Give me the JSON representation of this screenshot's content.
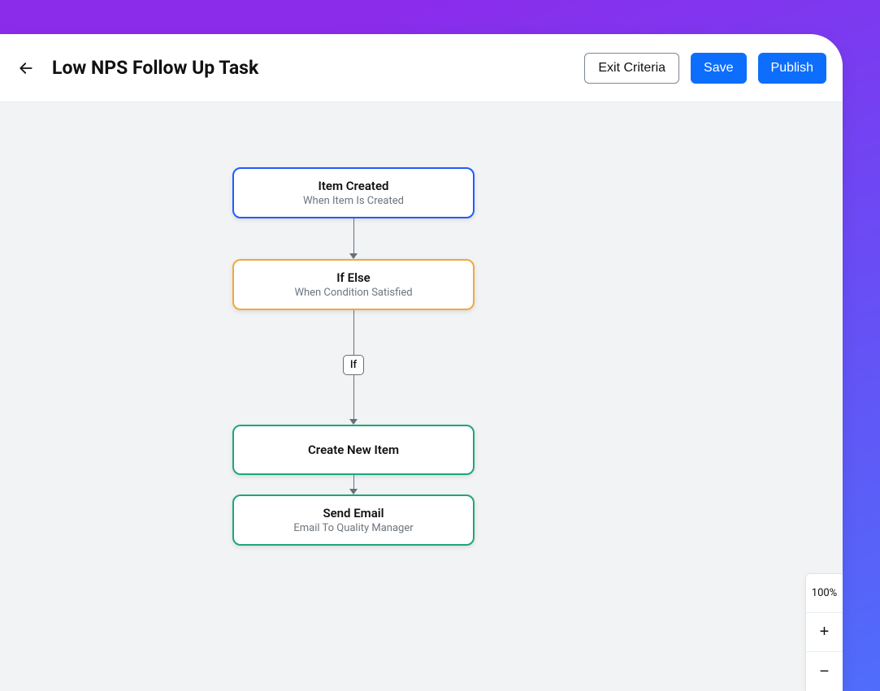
{
  "header": {
    "title": "Low NPS Follow Up Task",
    "exit_criteria_label": "Exit Criteria",
    "save_label": "Save",
    "publish_label": "Publish"
  },
  "flow": {
    "nodes": [
      {
        "title": "Item Created",
        "subtitle": "When Item Is Created",
        "style": "blue"
      },
      {
        "title": "If Else",
        "subtitle": "When Condition Satisfied",
        "style": "orange"
      },
      {
        "title": "Create New Item",
        "subtitle": "",
        "style": "teal"
      },
      {
        "title": "Send Email",
        "subtitle": "Email To Quality Manager",
        "style": "teal"
      }
    ],
    "branch_label": "If"
  },
  "zoom": {
    "value": "100%",
    "plus": "+",
    "minus": "−"
  }
}
